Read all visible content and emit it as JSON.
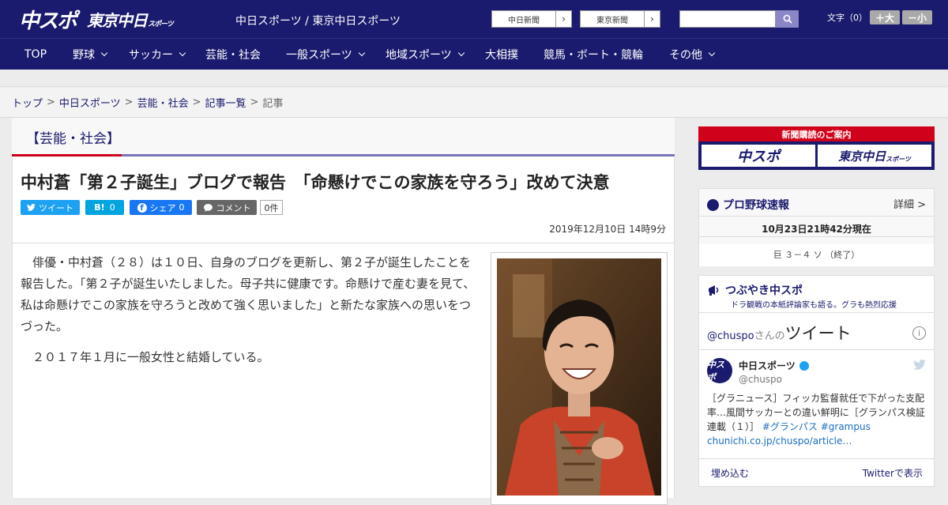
{
  "header": {
    "logo1": "中スポ",
    "logo2": "東京中日",
    "logo2_suffix": "スポーツ",
    "site_title": "中日スポーツ / 東京中日スポーツ",
    "paper_button_1": "中日新聞",
    "paper_button_2": "東京新聞",
    "font_size_label": "文字（0）",
    "font_plus": "＋大",
    "font_minus": "－小"
  },
  "nav": {
    "items": [
      "TOP",
      "野球",
      "サッカー",
      "芸能・社会",
      "一般スポーツ",
      "地域スポーツ",
      "大相撲",
      "競馬・ボート・競輪",
      "その他"
    ]
  },
  "breadcrumb": {
    "items": [
      "トップ",
      "中日スポーツ",
      "芸能・社会",
      "記事一覧",
      "記事"
    ],
    "separator": ">"
  },
  "article": {
    "category": "【芸能・社会】",
    "headline": "中村蒼「第２子誕生」ブログで報告　「命懸けでこの家族を守ろう」改めて決意",
    "share": {
      "tweet": "ツイート",
      "hatena": "B!",
      "hatena_count": "0",
      "facebook": "シェア",
      "facebook_count": "0",
      "comment": "コメント",
      "count": "0件"
    },
    "date": "2019年12月10日 14時9分",
    "paragraphs": [
      "　俳優・中村蒼（２８）は１０日、自身のブログを更新し、第２子が誕生したことを報告した。「第２子が誕生いたしました。母子共に健康です。命懸けで産む妻を見て、私は命懸けでこの家族を守ろうと改めて強く思いました」と新たな家族への思いをつづった。",
      "　２０１７年１月に一般女性と結婚している。"
    ]
  },
  "sidebar": {
    "ad": {
      "top": "新聞購読のご案内",
      "logo1": "中スポ",
      "logo2": "東京中日",
      "logo2_suffix": "スポーツ"
    },
    "baseball": {
      "title": "プロ野球速報",
      "more": "詳細 >",
      "time": "10月23日21時42分現在",
      "score": "巨 ３－４ ソ （終了）"
    },
    "tweets": {
      "title": "つぶやき中スポ",
      "subtitle": "ドラ観戦の本紙評論家も語る。グラも熱烈応援",
      "handle_prefix": "@chuspo",
      "handle_suffix": "さんの",
      "timeline_label": "ツイート",
      "info": "i",
      "avatar_text": "中スポ",
      "name": "中日スポーツ",
      "handle": "@chuspo",
      "text": "［グラニュース］フィッカ監督就任で下がった支配率…風間サッカーとの違い鮮明に［グランパス検証連載（１）］",
      "tags": "#グランパス #grampus",
      "link": "chunichi.co.jp/chuspo/article…",
      "embed": "埋め込む",
      "view": "Twitterで表示"
    }
  }
}
